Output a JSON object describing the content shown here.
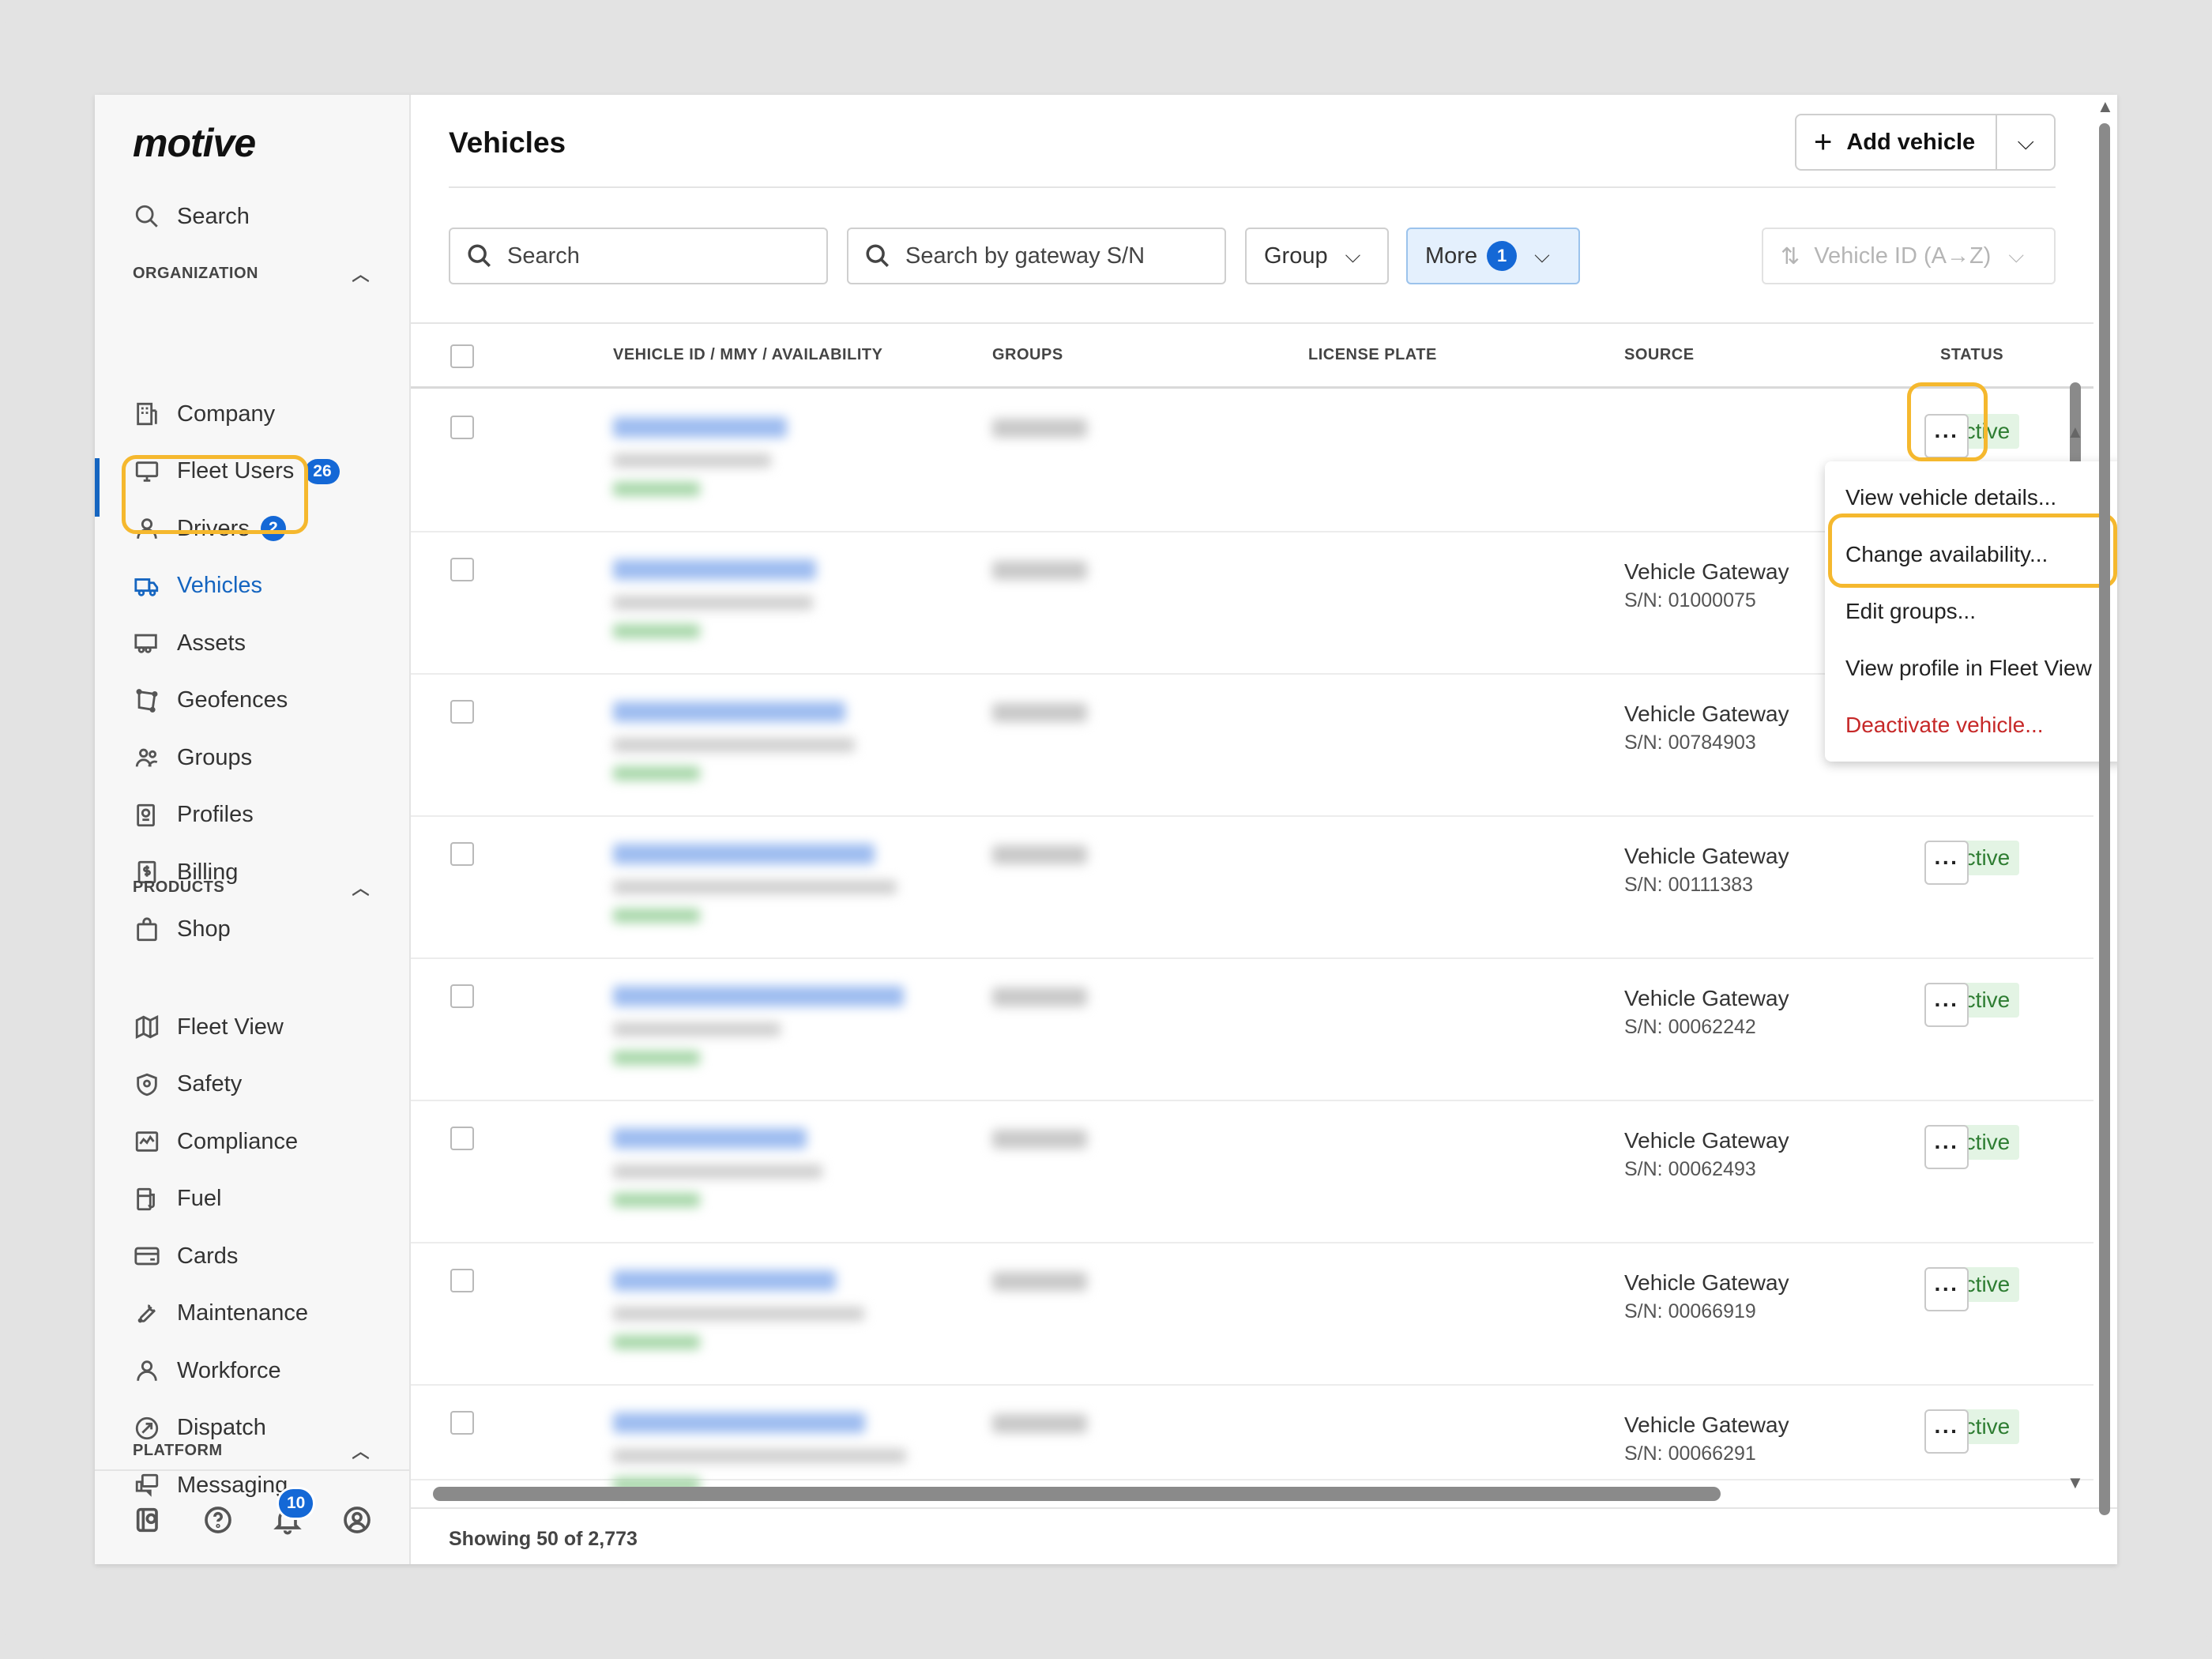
{
  "app": {
    "logo": "motive"
  },
  "sidebar": {
    "search_label": "Search",
    "org_section": "ORGANIZATION",
    "products_section": "PRODUCTS",
    "platform_section": "PLATFORM",
    "org_items": [
      {
        "label": "Company",
        "icon": "building-icon"
      },
      {
        "label": "Fleet Users",
        "icon": "monitor-icon",
        "badge": "26"
      },
      {
        "label": "Drivers",
        "icon": "person-icon",
        "badge": "2"
      },
      {
        "label": "Vehicles",
        "icon": "truck-icon",
        "active": true
      },
      {
        "label": "Assets",
        "icon": "trailer-icon"
      },
      {
        "label": "Geofences",
        "icon": "geofence-icon"
      },
      {
        "label": "Groups",
        "icon": "groups-icon"
      },
      {
        "label": "Profiles",
        "icon": "profile-settings-icon"
      },
      {
        "label": "Billing",
        "icon": "billing-icon"
      },
      {
        "label": "Shop",
        "icon": "shopping-bag-icon"
      }
    ],
    "product_items": [
      {
        "label": "Fleet View",
        "icon": "map-icon"
      },
      {
        "label": "Safety",
        "icon": "shield-icon"
      },
      {
        "label": "Compliance",
        "icon": "compliance-icon"
      },
      {
        "label": "Fuel",
        "icon": "fuel-icon"
      },
      {
        "label": "Cards",
        "icon": "card-icon"
      },
      {
        "label": "Maintenance",
        "icon": "wrench-icon"
      },
      {
        "label": "Workforce",
        "icon": "person-icon"
      },
      {
        "label": "Dispatch",
        "icon": "dispatch-icon"
      },
      {
        "label": "Messaging",
        "icon": "messaging-icon"
      }
    ],
    "footer": {
      "notification_count": "10"
    }
  },
  "header": {
    "title": "Vehicles",
    "add_button": "Add vehicle"
  },
  "filters": {
    "search_placeholder": "Search",
    "gateway_placeholder": "Search by gateway S/N",
    "group_label": "Group",
    "more_label": "More",
    "more_count": "1",
    "sort_label": "Vehicle ID (A→Z)"
  },
  "table": {
    "columns": [
      "VEHICLE ID / MMY / AVAILABILITY",
      "GROUPS",
      "LICENSE PLATE",
      "SOURCE",
      "STATUS"
    ],
    "rows": [
      {
        "source": "",
        "sn": "",
        "status": "Active"
      },
      {
        "source": "Vehicle Gateway",
        "sn": "S/N: 01000075",
        "status": ""
      },
      {
        "source": "Vehicle Gateway",
        "sn": "S/N: 00784903",
        "status": ""
      },
      {
        "source": "Vehicle Gateway",
        "sn": "S/N: 00111383",
        "status": "Active"
      },
      {
        "source": "Vehicle Gateway",
        "sn": "S/N: 00062242",
        "status": "Active"
      },
      {
        "source": "Vehicle Gateway",
        "sn": "S/N: 00062493",
        "status": "Active"
      },
      {
        "source": "Vehicle Gateway",
        "sn": "S/N: 00066919",
        "status": "Active"
      },
      {
        "source": "Vehicle Gateway",
        "sn": "S/N: 00066291",
        "status": "Active"
      }
    ],
    "kebab": "···"
  },
  "menu": {
    "items": [
      "View vehicle details...",
      "Change availability...",
      "Edit groups...",
      "View profile in Fleet View",
      "Deactivate vehicle..."
    ]
  },
  "footer": {
    "showing": "Showing 50 of 2,773"
  },
  "colors": {
    "accent": "#1468d6",
    "highlight": "#f5b82e",
    "active_status": "#2e7d32",
    "danger": "#c62828"
  }
}
